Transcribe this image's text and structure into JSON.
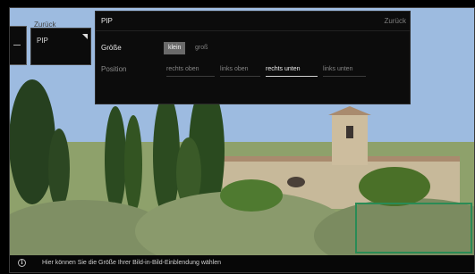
{
  "pip_tile": {
    "ghost_label": "Zurück",
    "label": "PIP"
  },
  "settings": {
    "title": "PIP",
    "back_label": "Zurück",
    "size": {
      "label": "Größe",
      "options": [
        "klein",
        "groß"
      ],
      "selected": "klein"
    },
    "position": {
      "label": "Position",
      "options": [
        "rechts oben",
        "links oben",
        "rechts unten",
        "links unten"
      ],
      "selected": "rechts unten"
    }
  },
  "info_bar": {
    "icon": "info-icon",
    "text": "Hier können Sie die Größe Ihrer Bild-in-Bild-Einblendung wählen"
  },
  "colors": {
    "pip_frame": "#2a8b55",
    "panel_bg": "#0c0c0c",
    "selected_bg": "#6a6a6a"
  }
}
